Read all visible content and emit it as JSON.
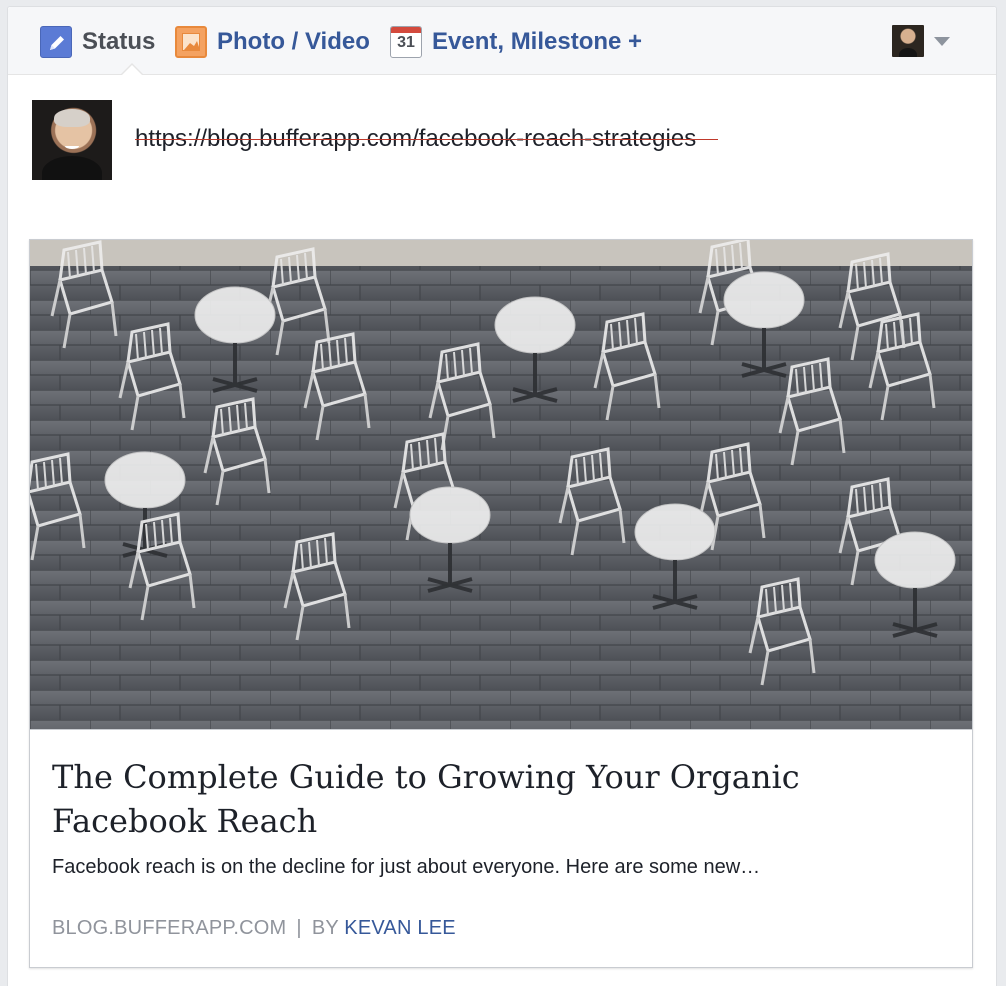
{
  "composer": {
    "tabs": [
      {
        "label": "Status",
        "icon": "pencil-icon",
        "active": true
      },
      {
        "label": "Photo / Video",
        "icon": "photo-icon",
        "active": false
      },
      {
        "label": "Event, Milestone +",
        "icon": "calendar-icon",
        "calendar_day": "31",
        "active": false
      }
    ],
    "post_text": "https://blog.bufferapp.com/facebook-reach-strategies",
    "privacy_icon": "avatar-icon"
  },
  "link_preview": {
    "title": "The Complete Guide to Growing Your Organic Facebook Reach",
    "description": "Facebook reach is on the decline for just about everyone. Here are some new…",
    "domain": "BLOG.BUFFERAPP.COM",
    "separator": "|",
    "by_label": "BY",
    "author": "KEVAN LEE",
    "image_icon": "outdoor-cafe-tables-chairs-image"
  },
  "colors": {
    "link_blue": "#365899",
    "status_text": "#4b4f56",
    "meta_gray": "#90949c",
    "status_icon_blue": "#5b7bd5",
    "photo_icon_orange": "#f4a261",
    "calendar_red": "#d34a3d"
  }
}
